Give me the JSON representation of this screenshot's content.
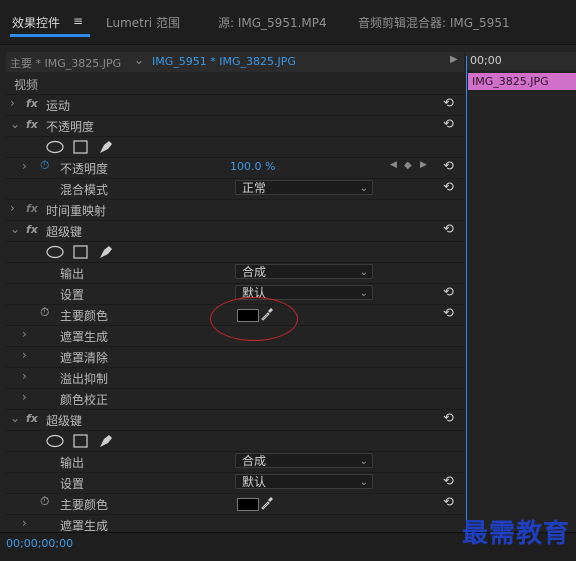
{
  "tabs": [
    {
      "label": "效果控件"
    },
    {
      "label": "Lumetri 范围"
    },
    {
      "label": "源: IMG_5951.MP4"
    },
    {
      "label": "音频剪辑混合器: IMG_5951"
    }
  ],
  "tab_menu_icon": "≡",
  "clip_header": {
    "master": "主要 * IMG_3825.JPG",
    "sequence": "IMG_5951 * IMG_3825.JPG",
    "play": "▶"
  },
  "section_video": "视频",
  "effects": {
    "motion": "运动",
    "opacity": "不透明度",
    "opacity_param": "不透明度",
    "opacity_value": "100.0 %",
    "blend_mode": "混合模式",
    "blend_value": "正常",
    "time_remap": "时间重映射",
    "ultra_key_1": "超级键",
    "output": "输出",
    "output_value": "合成",
    "settings": "设置",
    "settings_value": "默认",
    "key_color": "主要颜色",
    "matte_gen": "遮罩生成",
    "matte_cleanup": "遮罩清除",
    "spill": "溢出抑制",
    "color_corr": "颜色校正",
    "ultra_key_2": "超级键",
    "output2": "输出",
    "output2_value": "合成",
    "settings2": "设置",
    "settings2_value": "默认",
    "key_color2": "主要颜色",
    "matte_gen2": "遮罩生成"
  },
  "fx_badge": "fx",
  "reset_icon": "⟲",
  "timeline": {
    "ruler_time": "00;00",
    "clip_name": "IMG_3825.JPG"
  },
  "timecode": "00;00;00;00",
  "watermark": "最需教育",
  "colors": {
    "accent": "#2d8ceb",
    "clip": "#d070c8",
    "annotation": "#c0262a",
    "watermark": "#1e3fc0"
  }
}
